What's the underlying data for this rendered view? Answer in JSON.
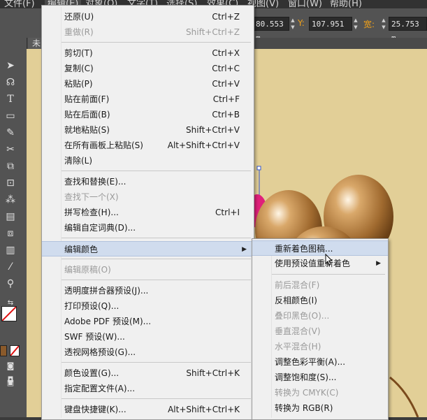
{
  "menubar": {
    "items": [
      {
        "label": "文件(F)"
      },
      {
        "label": "编辑(E)"
      },
      {
        "label": "对象(O)"
      },
      {
        "label": "文字(T)"
      },
      {
        "label": "选择(S)"
      },
      {
        "label": "效果(C)"
      },
      {
        "label": "视图(V)"
      },
      {
        "label": "窗口(W)"
      },
      {
        "label": "帮助(H)"
      }
    ]
  },
  "controlbar": {
    "x_value": "80.553 m",
    "y_label": "Y:",
    "y_value": "107.951",
    "w_label": "宽:",
    "w_value": "25.753 m"
  },
  "doc_tab": {
    "label": "未"
  },
  "edit_menu": {
    "items": [
      {
        "label": "还原(U)",
        "shortcut": "Ctrl+Z",
        "disabled": false
      },
      {
        "label": "重做(R)",
        "shortcut": "Shift+Ctrl+Z",
        "disabled": true
      },
      {
        "label": "剪切(T)",
        "shortcut": "Ctrl+X",
        "disabled": false
      },
      {
        "label": "复制(C)",
        "shortcut": "Ctrl+C",
        "disabled": false
      },
      {
        "label": "粘贴(P)",
        "shortcut": "Ctrl+V",
        "disabled": false
      },
      {
        "label": "贴在前面(F)",
        "shortcut": "Ctrl+F",
        "disabled": false
      },
      {
        "label": "贴在后面(B)",
        "shortcut": "Ctrl+B",
        "disabled": false
      },
      {
        "label": "就地粘贴(S)",
        "shortcut": "Shift+Ctrl+V",
        "disabled": false
      },
      {
        "label": "在所有画板上粘贴(S)",
        "shortcut": "Alt+Shift+Ctrl+V",
        "disabled": false
      },
      {
        "label": "清除(L)",
        "shortcut": "",
        "disabled": false
      },
      {
        "label": "查找和替换(E)...",
        "shortcut": "",
        "disabled": false
      },
      {
        "label": "查找下一个(X)",
        "shortcut": "",
        "disabled": true
      },
      {
        "label": "拼写检查(H)...",
        "shortcut": "Ctrl+I",
        "disabled": false
      },
      {
        "label": "编辑自定词典(D)...",
        "shortcut": "",
        "disabled": false
      },
      {
        "label": "编辑颜色",
        "shortcut": "",
        "disabled": false
      },
      {
        "label": "编辑原稿(O)",
        "shortcut": "",
        "disabled": true
      },
      {
        "label": "透明度拼合器预设(J)...",
        "shortcut": "",
        "disabled": false
      },
      {
        "label": "打印预设(Q)...",
        "shortcut": "",
        "disabled": false
      },
      {
        "label": "Adobe PDF 预设(M)...",
        "shortcut": "",
        "disabled": false
      },
      {
        "label": "SWF 预设(W)...",
        "shortcut": "",
        "disabled": false
      },
      {
        "label": "透视网格预设(G)...",
        "shortcut": "",
        "disabled": false
      },
      {
        "label": "颜色设置(G)...",
        "shortcut": "Shift+Ctrl+K",
        "disabled": false
      },
      {
        "label": "指定配置文件(A)...",
        "shortcut": "",
        "disabled": false
      },
      {
        "label": "键盘快捷键(K)...",
        "shortcut": "Alt+Shift+Ctrl+K",
        "disabled": false
      }
    ]
  },
  "color_submenu": {
    "items": [
      {
        "label": "重新着色图稿...",
        "disabled": false
      },
      {
        "label": "使用预设值重新着色",
        "disabled": false
      },
      {
        "label": "前后混合(F)",
        "disabled": true
      },
      {
        "label": "反相颜色(I)",
        "disabled": false
      },
      {
        "label": "叠印黑色(O)...",
        "disabled": true
      },
      {
        "label": "垂直混合(V)",
        "disabled": true
      },
      {
        "label": "水平混合(H)",
        "disabled": true
      },
      {
        "label": "调整色彩平衡(A)...",
        "disabled": false
      },
      {
        "label": "调整饱和度(S)...",
        "disabled": false
      },
      {
        "label": "转换为 CMYK(C)",
        "disabled": true
      },
      {
        "label": "转换为 RGB(R)",
        "disabled": false
      }
    ]
  },
  "colors": {
    "canvas": "#e2cf97",
    "menu_bg": "#f0f0f0",
    "highlight": "#d0dcee",
    "accent_label": "#f0a11a"
  }
}
